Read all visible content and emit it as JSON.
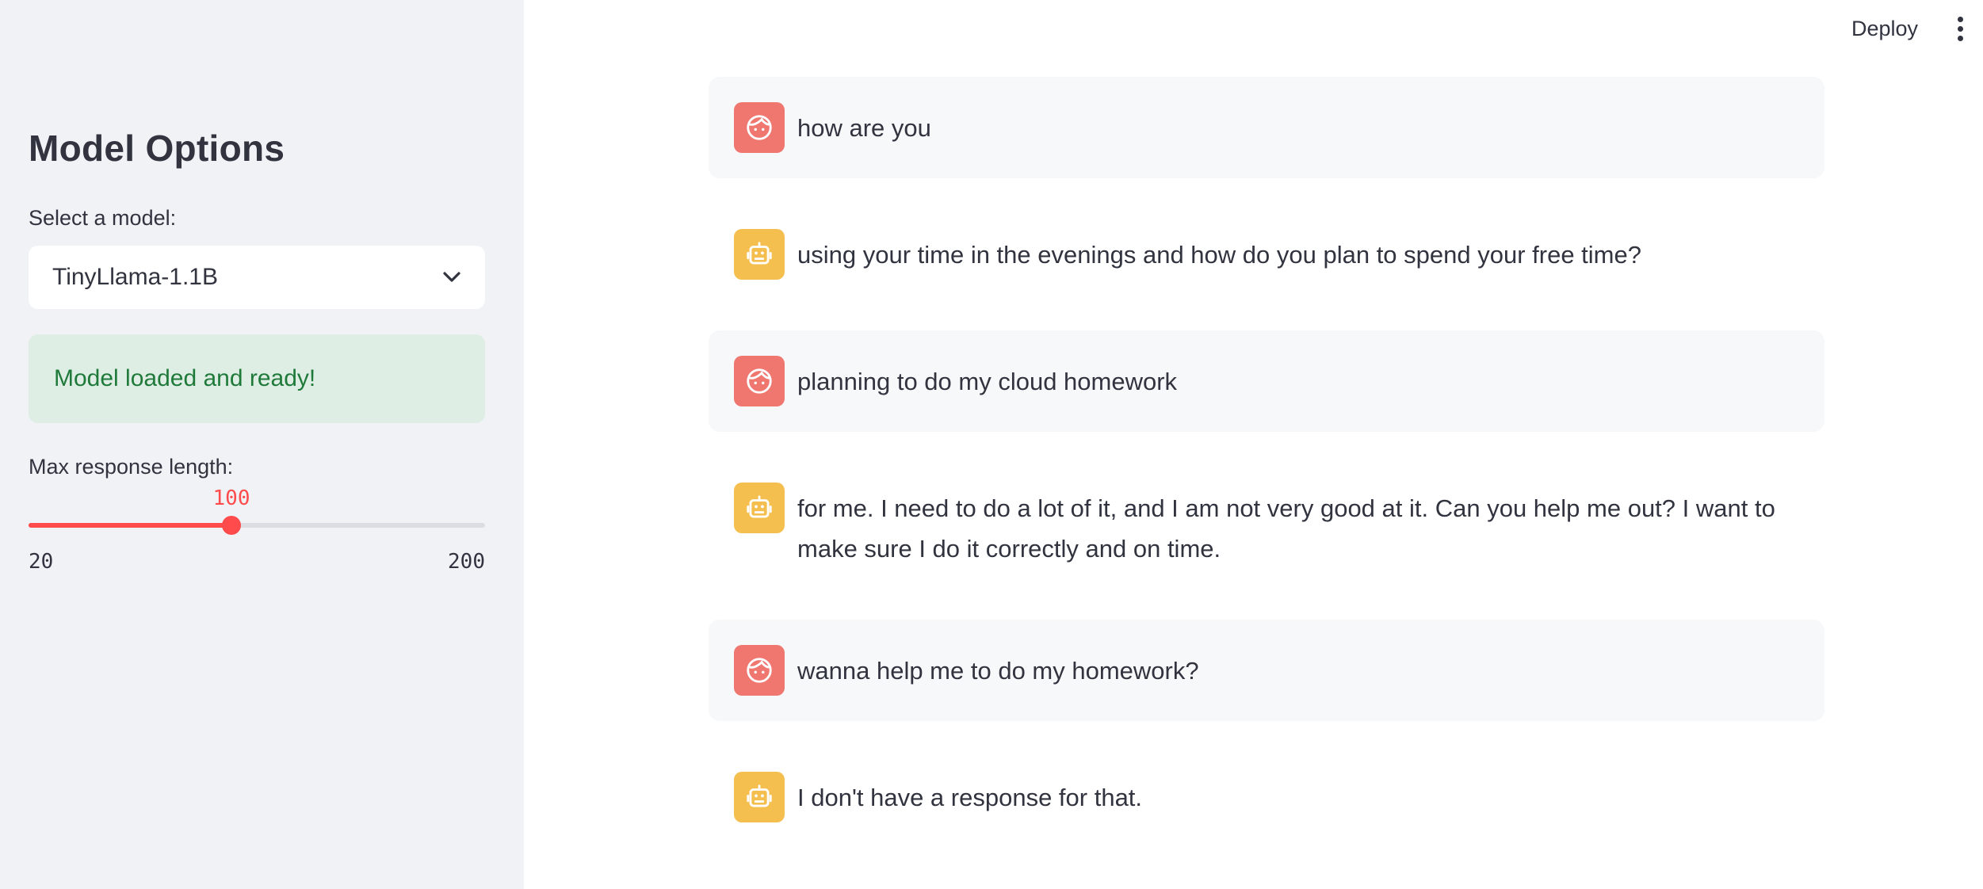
{
  "sidebar": {
    "title": "Model Options",
    "select_label": "Select a model:",
    "selected_model": "TinyLlama-1.1B",
    "status_message": "Model loaded and ready!",
    "slider": {
      "label": "Max response length:",
      "value": 100,
      "min": 20,
      "max": 200,
      "value_label": "100",
      "min_label": "20",
      "max_label": "200"
    }
  },
  "header": {
    "deploy_label": "Deploy"
  },
  "colors": {
    "accent": "#ff4b4b",
    "user_avatar": "#f07770",
    "assistant_avatar": "#f5bf4f",
    "success_bg": "#dfeee5",
    "success_text": "#1f7a3a"
  },
  "chat": {
    "messages": [
      {
        "role": "user",
        "icon": "user-face-icon",
        "text": "how are you"
      },
      {
        "role": "assistant",
        "icon": "robot-icon",
        "text": "using your time in the evenings and how do you plan to spend your free time?"
      },
      {
        "role": "user",
        "icon": "user-face-icon",
        "text": "planning to do my cloud homework"
      },
      {
        "role": "assistant",
        "icon": "robot-icon",
        "text": "for me. I need to do a lot of it, and I am not very good at it. Can you help me out? I want to make sure I do it correctly and on time."
      },
      {
        "role": "user",
        "icon": "user-face-icon",
        "text": "wanna help me to do my homework?"
      },
      {
        "role": "assistant",
        "icon": "robot-icon",
        "text": "I don't have a response for that."
      }
    ]
  }
}
